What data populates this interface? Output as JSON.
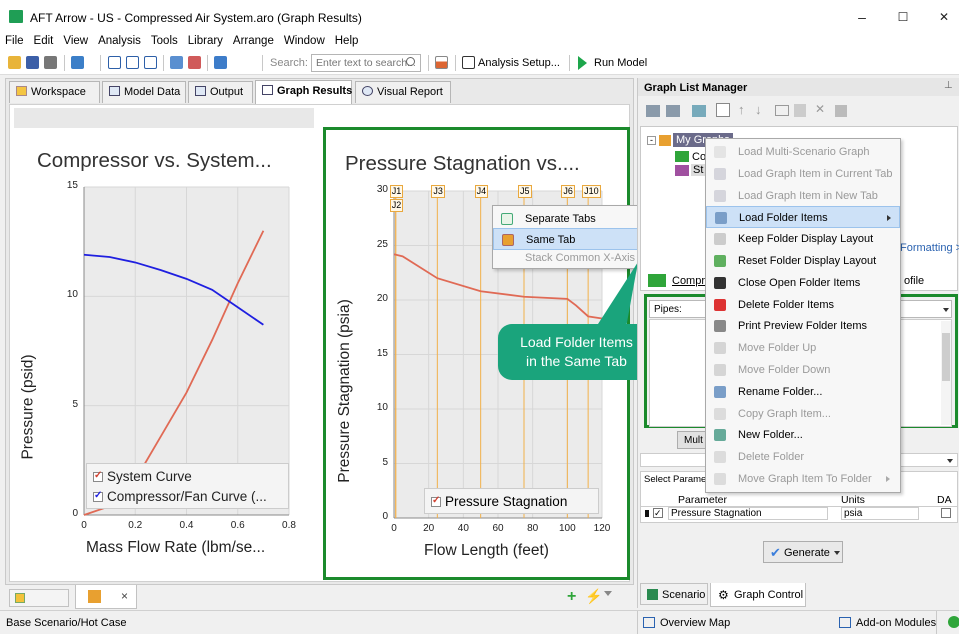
{
  "window": {
    "title": "AFT Arrow - US - Compressed Air System.aro (Graph Results)",
    "minimize": "–",
    "maximize": "☐",
    "close": "✕"
  },
  "menu": [
    "File",
    "Edit",
    "View",
    "Analysis",
    "Tools",
    "Library",
    "Arrange",
    "Window",
    "Help"
  ],
  "toolbar": {
    "search_label": "Search:",
    "search_placeholder": "Enter text to search...",
    "analysis_setup": "Analysis Setup...",
    "run_model": "Run Model"
  },
  "tabs": [
    "Workspace",
    "Model Data",
    "Output",
    "Graph Results",
    "Visual Report"
  ],
  "chart_data": [
    {
      "type": "line",
      "title": "Compressor vs. System...",
      "xlabel": "Mass Flow Rate (lbm/se...",
      "ylabel": "Pressure (psid)",
      "xlim": [
        0,
        0.8
      ],
      "ylim": [
        0,
        15
      ],
      "xticks": [
        "0",
        "0.2",
        "0.4",
        "0.6",
        "0.8"
      ],
      "yticks": [
        "0",
        "5",
        "10",
        "15"
      ],
      "series": [
        {
          "name": "System Curve",
          "color": "#e06a55",
          "x": [
            0,
            0.1,
            0.2,
            0.3,
            0.4,
            0.5,
            0.6,
            0.7
          ],
          "y": [
            0,
            0.4,
            1.6,
            3.6,
            5.6,
            8.0,
            10.6,
            13.0
          ]
        },
        {
          "name": "Compressor/Fan Curve (...",
          "color": "#1f1fe0",
          "x": [
            0.0,
            0.1,
            0.2,
            0.3,
            0.4,
            0.5,
            0.6,
            0.7
          ],
          "y": [
            11.9,
            11.8,
            11.55,
            11.2,
            10.8,
            10.3,
            9.5,
            8.7
          ]
        }
      ]
    },
    {
      "type": "line",
      "title": "Pressure Stagnation vs....",
      "xlabel": "Flow Length (feet)",
      "ylabel": "Pressure Stagnation (psia)",
      "xlim": [
        0,
        120
      ],
      "ylim": [
        0,
        30
      ],
      "xticks": [
        "0",
        "20",
        "40",
        "60",
        "80",
        "100",
        "120"
      ],
      "yticks": [
        "0",
        "5",
        "10",
        "15",
        "20",
        "25",
        "30"
      ],
      "series": [
        {
          "name": "Pressure Stagnation",
          "color": "#e06a55",
          "x": [
            0,
            5,
            25,
            50,
            75,
            100,
            105,
            112,
            120
          ],
          "y": [
            24.2,
            24.0,
            22.0,
            20.8,
            20.3,
            20.1,
            19.5,
            18.5,
            18.3
          ]
        }
      ],
      "junctions": [
        {
          "label": "J1",
          "x": 1
        },
        {
          "label": "J2",
          "x": 1
        },
        {
          "label": "J3",
          "x": 25
        },
        {
          "label": "J4",
          "x": 50
        },
        {
          "label": "J5",
          "x": 75
        },
        {
          "label": "J6",
          "x": 100
        },
        {
          "label": "J10",
          "x": 112
        }
      ]
    }
  ],
  "submenu": {
    "items": [
      "Separate Tabs",
      "Same Tab",
      "Stack Common X-Axis in Same Tab"
    ],
    "disabled": [
      false,
      false,
      true
    ],
    "hover": [
      false,
      true,
      false
    ]
  },
  "callout": {
    "line1": "Load Folder Items",
    "line2": "in the Same Tab"
  },
  "bottom_tabs": [
    "",
    ""
  ],
  "status": {
    "scenario": "Base Scenario/Hot Case",
    "overview_map": "Overview Map",
    "addon_modules": "Add-on Modules"
  },
  "right_panel": {
    "title": "Graph List Manager",
    "pin": "⊥",
    "tree": {
      "root": "My Graphs",
      "items": [
        "Co",
        "St"
      ]
    },
    "formatting": "Formatting >",
    "list_item": "Compre",
    "list_item_right": "ofile",
    "pipes_label": "Pipes:",
    "mult_btn": "Mult",
    "select_params": "Select Parame",
    "param_header": "Parameter",
    "units_header": "Units",
    "da_header": "DA",
    "param_row": {
      "name": "Pressure Stagnation",
      "units": "psia"
    },
    "generate": "Generate",
    "scenario_tab": "Scenario",
    "graph_control_tab": "Graph Control"
  },
  "context_menu": {
    "items": [
      {
        "label": "Load Multi-Scenario Graph",
        "disabled": true
      },
      {
        "label": "Load Graph Item in Current Tab",
        "disabled": true
      },
      {
        "label": "Load Graph Item in New Tab",
        "disabled": true
      },
      {
        "label": "Load Folder Items",
        "disabled": false,
        "hover": true,
        "submenu": true
      },
      {
        "label": "Keep Folder Display Layout",
        "disabled": false
      },
      {
        "label": "Reset Folder Display Layout",
        "disabled": false
      },
      {
        "label": "Close Open Folder Items",
        "disabled": false
      },
      {
        "label": "Delete Folder Items",
        "disabled": false
      },
      {
        "label": "Print Preview Folder Items",
        "disabled": false
      },
      {
        "label": "Move Folder Up",
        "disabled": true
      },
      {
        "label": "Move Folder Down",
        "disabled": true
      },
      {
        "label": "Rename Folder...",
        "disabled": false
      },
      {
        "label": "Copy Graph Item...",
        "disabled": true
      },
      {
        "label": "New Folder...",
        "disabled": false
      },
      {
        "label": "Delete Folder",
        "disabled": true
      },
      {
        "label": "Move Graph Item To Folder",
        "disabled": true,
        "submenu": true
      }
    ]
  }
}
